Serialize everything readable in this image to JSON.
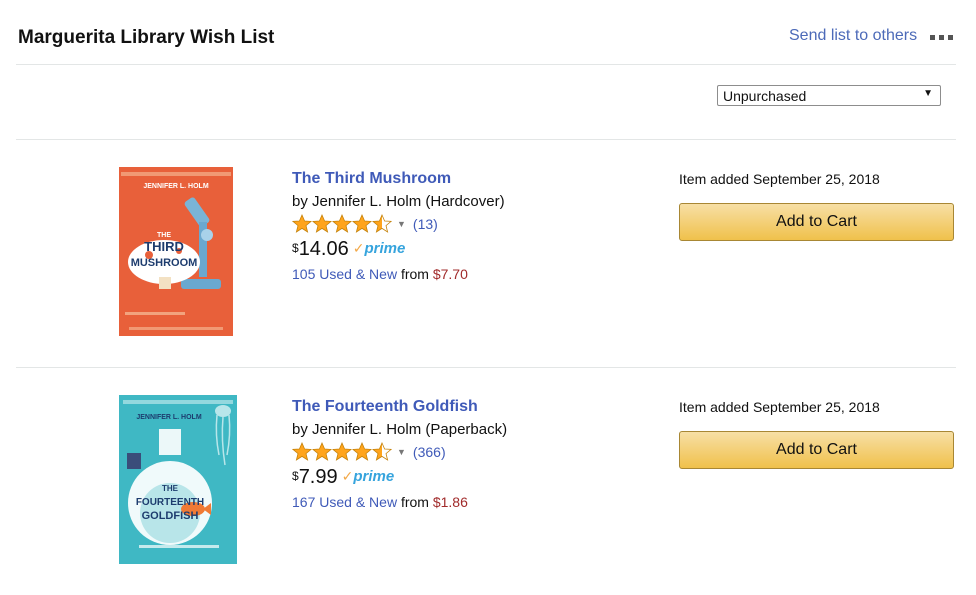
{
  "header": {
    "title": "Marguerita Library Wish List",
    "send_link": "Send list to others"
  },
  "filter": {
    "selected": "Unpurchased",
    "arrow": "▼"
  },
  "items": [
    {
      "title": "The Third Mushroom",
      "byline": "by Jennifer L. Holm (Hardcover)",
      "rating": 4.5,
      "rating_count": "(13)",
      "price_symbol": "$",
      "price": "14.06",
      "prime": "prime",
      "offers_link": "105 Used & New",
      "offers_from": "from",
      "offers_price": "$7.70",
      "added": "Item added September 25, 2018",
      "cart_label": "Add to Cart",
      "cover": {
        "author": "JENNIFER L. HOLM",
        "title_lines": [
          "THE",
          "THIRD",
          "MUSHROOM"
        ],
        "bg": "#e8603a"
      }
    },
    {
      "title": "The Fourteenth Goldfish",
      "byline": "by Jennifer L. Holm (Paperback)",
      "rating": 4.5,
      "rating_count": "(366)",
      "price_symbol": "$",
      "price": "7.99",
      "prime": "prime",
      "offers_link": "167 Used & New",
      "offers_from": "from",
      "offers_price": "$1.86",
      "added": "Item added September 25, 2018",
      "cart_label": "Add to Cart",
      "cover": {
        "author": "JENNIFER L. HOLM",
        "title_lines": [
          "THE",
          "FOURTEENTH",
          "GOLDFISH"
        ],
        "bg": "#3fb8c4"
      }
    }
  ],
  "colors": {
    "link": "#3f5ab8",
    "star": "#ffa41c",
    "price_offer": "#a12b2b",
    "prime_blue": "#36a4dd"
  }
}
